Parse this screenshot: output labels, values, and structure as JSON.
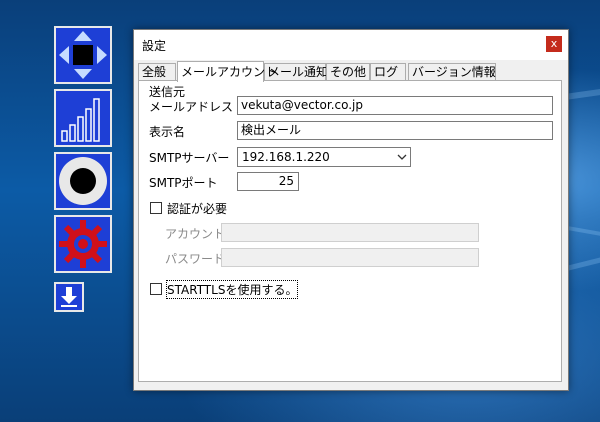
{
  "window": {
    "title": "設定",
    "close_glyph": "x"
  },
  "tabs": [
    {
      "label": "全般"
    },
    {
      "label": "メールアカウント"
    },
    {
      "label": "メール通知"
    },
    {
      "label": "その他"
    },
    {
      "label": "ログ"
    },
    {
      "label": "バージョン情報"
    }
  ],
  "sender": {
    "group_label": "送信元",
    "mail_address_label": "メールアドレス",
    "mail_address_value": "vekuta@vector.co.jp",
    "display_name_label": "表示名",
    "display_name_value": "検出メール",
    "smtp_server_label": "SMTPサーバー",
    "smtp_server_value": "192.168.1.220",
    "smtp_port_label": "SMTPポート",
    "smtp_port_value": "25",
    "auth_required_label": "認証が必要",
    "auth_required_checked": false,
    "account_label": "アカウント",
    "account_value": "",
    "password_label": "パスワード",
    "password_value": "",
    "starttls_label": "STARTTLSを使用する。",
    "starttls_checked": false
  },
  "toolbar": {
    "icons": [
      "move-arrows-icon",
      "bar-chart-icon",
      "record-icon",
      "gear-icon",
      "download-icon"
    ]
  },
  "colors": {
    "toolbar_bg": "#1e3fd6",
    "gear_red": "#d0101a",
    "close_red": "#c42b1c"
  }
}
